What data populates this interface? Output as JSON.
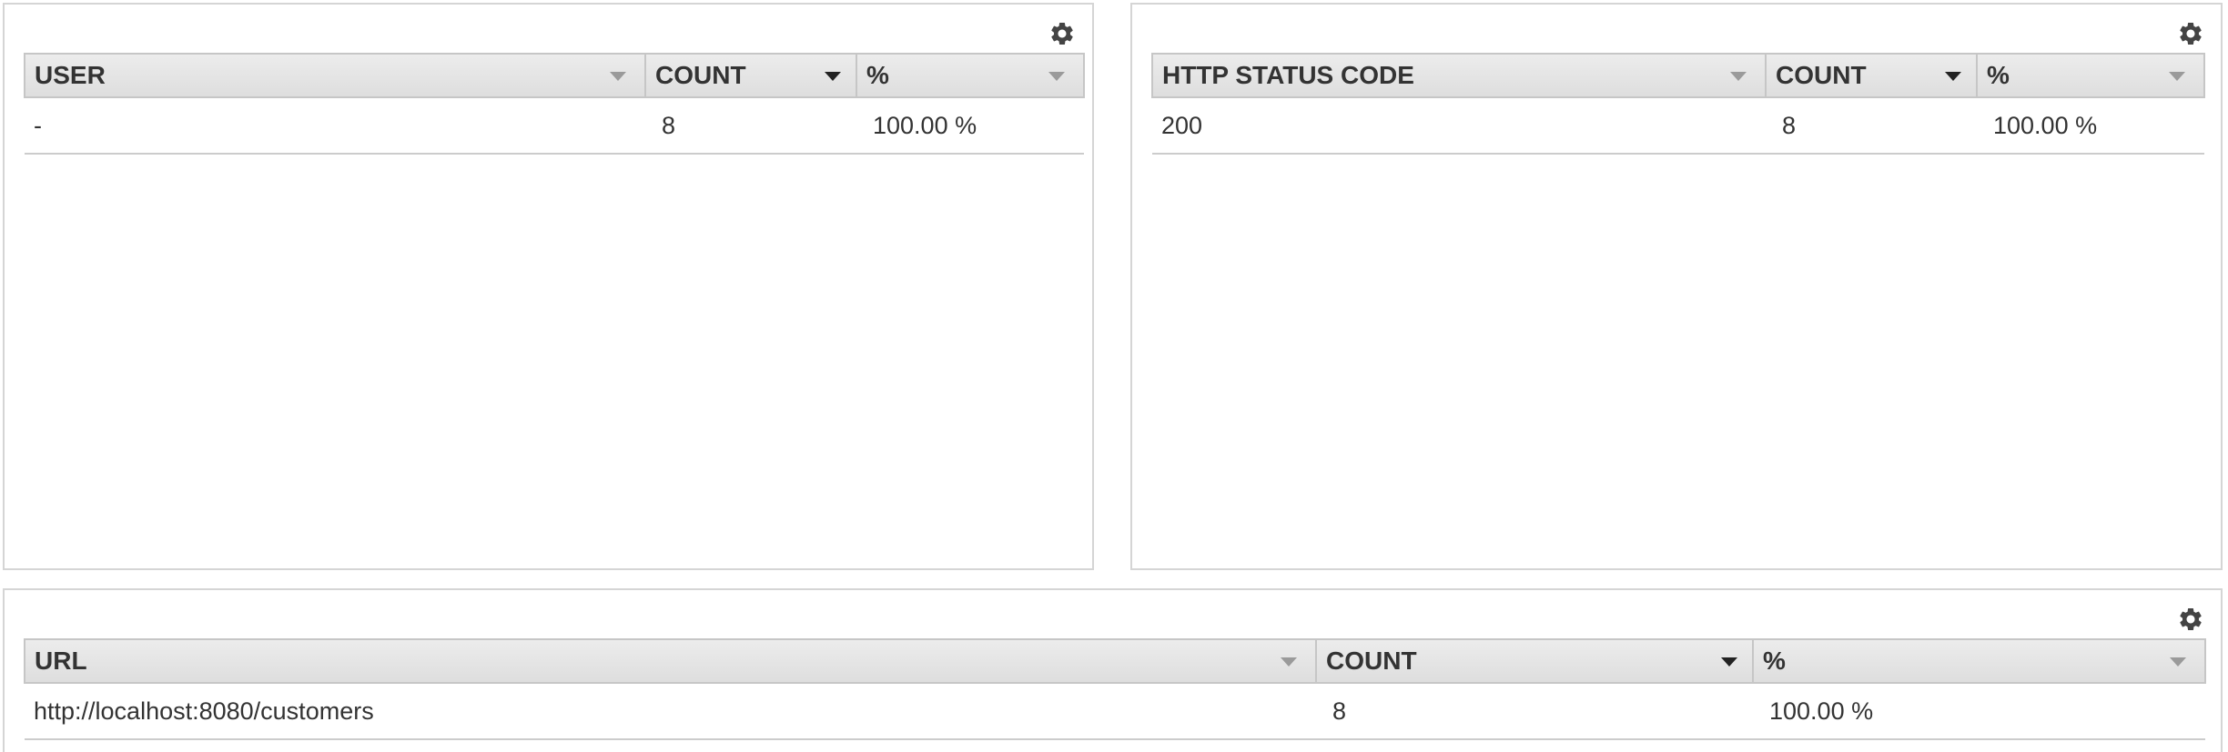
{
  "panels": {
    "user": {
      "columns": [
        "USER",
        "COUNT",
        "%"
      ],
      "rows": [
        {
          "key": "-",
          "count": "8",
          "percent": "100.00 %"
        }
      ]
    },
    "status": {
      "columns": [
        "HTTP STATUS CODE",
        "COUNT",
        "%"
      ],
      "rows": [
        {
          "key": "200",
          "count": "8",
          "percent": "100.00 %"
        }
      ]
    },
    "url": {
      "columns": [
        "URL",
        "COUNT",
        "%"
      ],
      "rows": [
        {
          "key": "http://localhost:8080/customers",
          "count": "8",
          "percent": "100.00 %"
        }
      ]
    }
  },
  "icons": {
    "settings": "gear-icon",
    "sort_inactive": "caret-down-icon",
    "sort_active": "caret-down-icon"
  },
  "colors": {
    "header_bg": "#e3e3e3",
    "border": "#d5d5d5",
    "text": "#333333",
    "caret_inactive": "#9a9a9a",
    "caret_active": "#222222"
  }
}
